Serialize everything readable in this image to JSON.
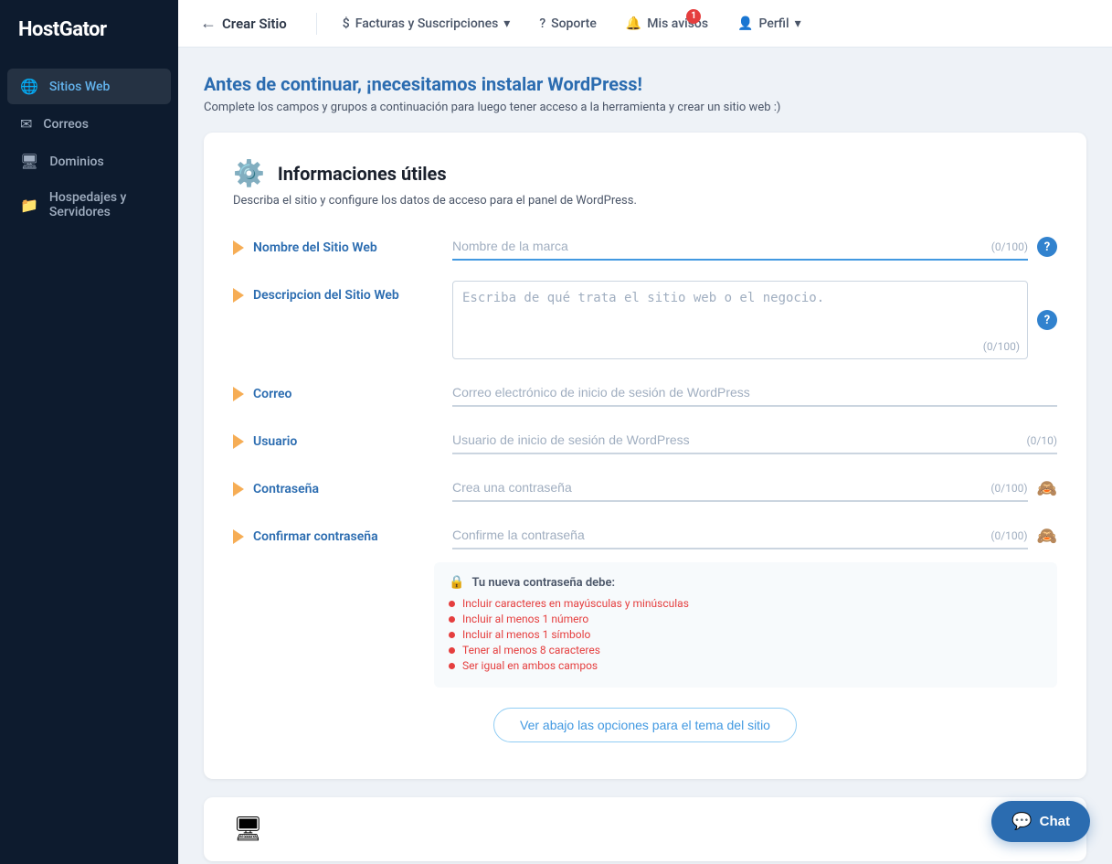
{
  "sidebar": {
    "logo": "HostGator",
    "logo_accent": "Host",
    "logo_rest": "Gator",
    "items": [
      {
        "id": "sitios-web",
        "label": "Sitios Web",
        "icon": "🌐",
        "active": true
      },
      {
        "id": "correos",
        "label": "Correos",
        "icon": "✉"
      },
      {
        "id": "dominios",
        "label": "Dominios",
        "icon": "🖥"
      },
      {
        "id": "hospedajes",
        "label": "Hospedajes y Servidores",
        "icon": "📁"
      }
    ]
  },
  "topnav": {
    "back_label": "Crear Sitio",
    "billing_label": "Facturas y Suscripciones",
    "support_label": "Soporte",
    "notifications_label": "Mis avisos",
    "notifications_count": "1",
    "profile_label": "Perfil"
  },
  "page": {
    "title_prefix": "Antes de continuar, ",
    "title_highlight": "¡necesitamos instalar WordPress!",
    "subtitle": "Complete los campos y grupos a continuación para luego tener acceso a la herramienta y crear un sitio web :)"
  },
  "card": {
    "icon": "⚙",
    "title": "Informaciones útiles",
    "subtitle": "Describa el sitio y configure los datos de acceso para el panel de WordPress.",
    "fields": [
      {
        "id": "site-name",
        "label": "Nombre del Sitio Web",
        "placeholder": "Nombre de la marca",
        "count": "(0/100)",
        "has_help": true,
        "type": "text"
      },
      {
        "id": "site-desc",
        "label": "Descripcion del Sitio Web",
        "placeholder": "Escriba de qué trata el sitio web o el negocio.",
        "count": "(0/100)",
        "has_help": true,
        "type": "textarea"
      },
      {
        "id": "correo",
        "label": "Correo",
        "placeholder": "Correo electrónico de inicio de sesión de WordPress",
        "count": "",
        "has_help": false,
        "type": "text"
      },
      {
        "id": "usuario",
        "label": "Usuario",
        "placeholder": "Usuario de inicio de sesión de WordPress",
        "count": "(0/10)",
        "has_help": false,
        "type": "text"
      },
      {
        "id": "contrasena",
        "label": "Contraseña",
        "placeholder": "Crea una contraseña",
        "count": "(0/100)",
        "has_help": false,
        "type": "password"
      },
      {
        "id": "confirmar-contrasena",
        "label": "Confirmar contraseña",
        "placeholder": "Confirme la contraseña",
        "count": "(0/100)",
        "has_help": false,
        "type": "password"
      }
    ],
    "password_requirements": {
      "header": "Tu nueva contraseña debe:",
      "items": [
        "Incluir caracteres en mayúsculas y minúsculas",
        "Incluir al menos 1 número",
        "Incluir al menos 1 símbolo",
        "Tener al menos 8 caracteres",
        "Ser igual en ambos campos"
      ]
    },
    "see_more_button": "Ver abajo las opciones para el tema del sitio"
  },
  "bottom_card": {
    "icon": "🖥"
  },
  "chat": {
    "label": "Chat",
    "icon": "💬"
  }
}
